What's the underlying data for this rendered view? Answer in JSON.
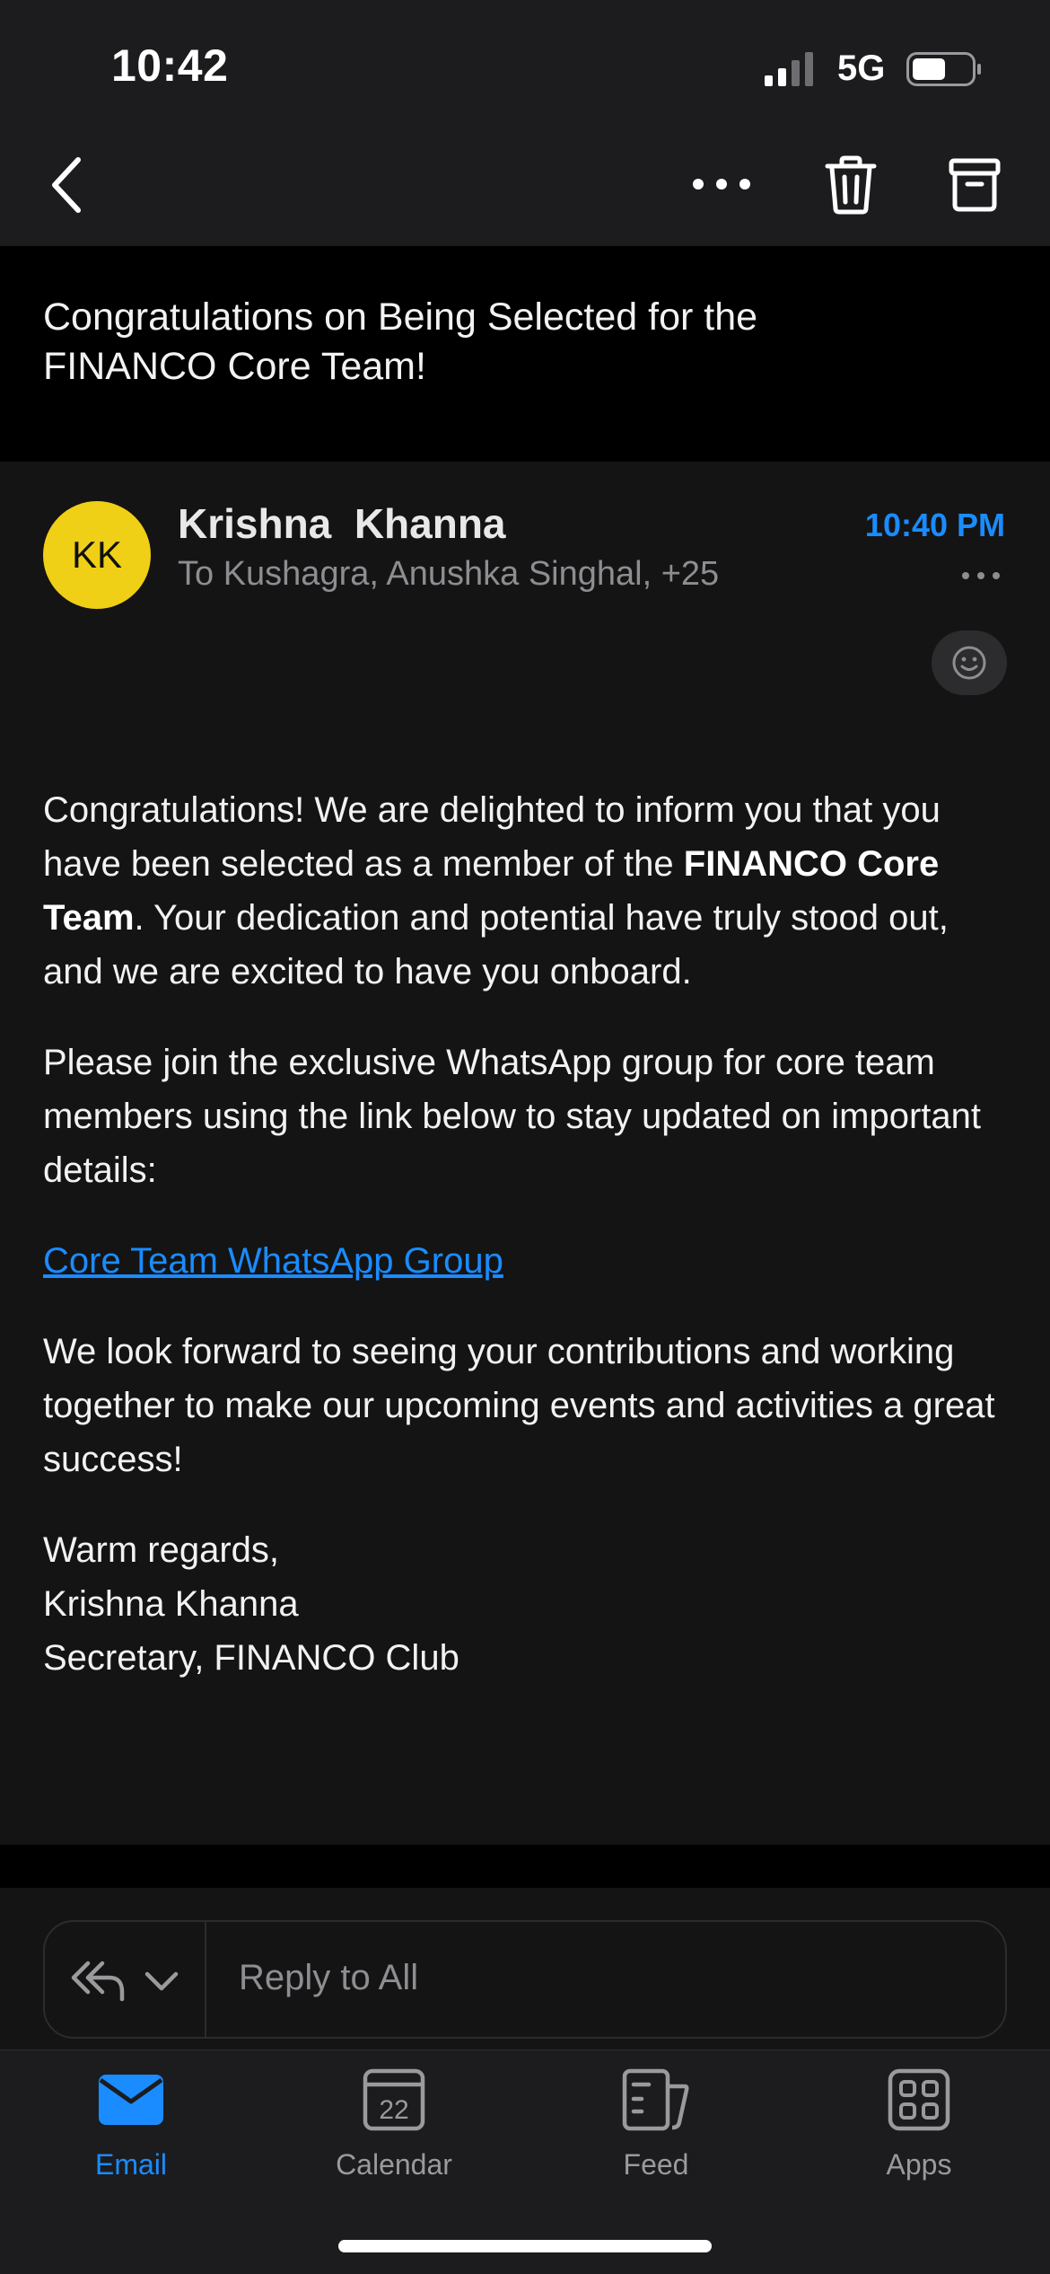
{
  "status_bar": {
    "time": "10:42",
    "network": "5G"
  },
  "toolbar": {
    "back_icon": "chevron-left-icon",
    "more_icon": "ellipsis-icon",
    "delete_icon": "trash-icon",
    "archive_icon": "archive-icon"
  },
  "email": {
    "subject": "Congratulations on Being Selected for the FINANCO Core Team!",
    "avatar_initials": "KK",
    "avatar_color": "#f0cf17",
    "sender": "Krishna  Khanna",
    "recipients": "To Kushagra, Anushka Singhal, +25",
    "time": "10:40 PM",
    "body": {
      "p1_a": "Congratulations! We are delighted to inform you that you have been selected as a member of the ",
      "p1_bold": "FINANCO Core Team",
      "p1_b": ". Your dedication and potential have truly stood out, and we are excited to have you onboard.",
      "p2": "Please join the exclusive WhatsApp group for core team members using the link below to stay updated on important details:",
      "link_text": "Core Team WhatsApp Group",
      "p3": "We look forward to seeing your contributions and working together to make our upcoming events and activities a great success!",
      "signoff": "Warm regards,",
      "sig_name": "Krishna Khanna",
      "sig_title": "Secretary, FINANCO Club"
    }
  },
  "reply": {
    "placeholder": "Reply to All"
  },
  "tabs": [
    {
      "label": "Email",
      "icon": "mail-icon",
      "active": true
    },
    {
      "label": "Calendar",
      "icon": "calendar-icon",
      "day": "22",
      "active": false
    },
    {
      "label": "Feed",
      "icon": "feed-icon",
      "active": false
    },
    {
      "label": "Apps",
      "icon": "apps-grid-icon",
      "active": false
    }
  ],
  "colors": {
    "accent": "#1a8cff",
    "background": "#141414",
    "toolbar": "#1c1c1e"
  }
}
